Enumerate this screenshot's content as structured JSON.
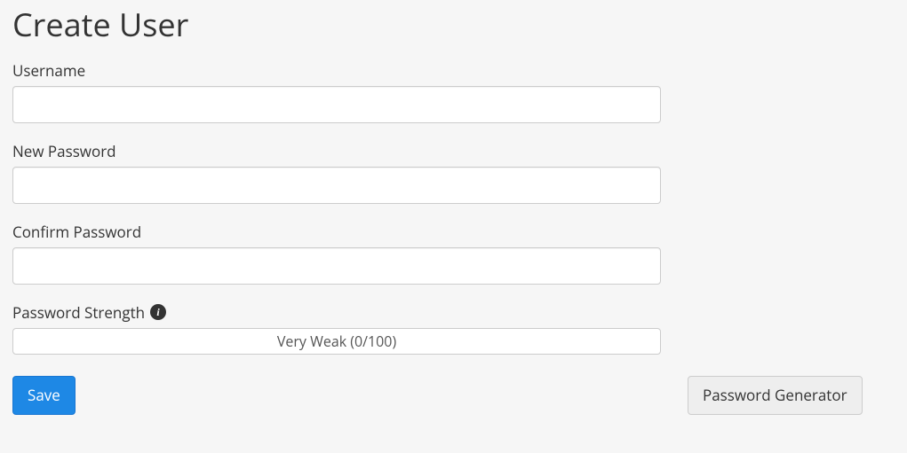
{
  "page": {
    "title": "Create User"
  },
  "form": {
    "username": {
      "label": "Username",
      "value": "",
      "placeholder": ""
    },
    "new_password": {
      "label": "New Password",
      "value": "",
      "placeholder": ""
    },
    "confirm_password": {
      "label": "Confirm Password",
      "value": "",
      "placeholder": ""
    },
    "strength": {
      "label": "Password Strength",
      "text": "Very Weak (0/100)",
      "score": 0,
      "max": 100
    }
  },
  "actions": {
    "save_label": "Save",
    "generator_label": "Password Generator"
  },
  "icons": {
    "info_glyph": "i"
  }
}
